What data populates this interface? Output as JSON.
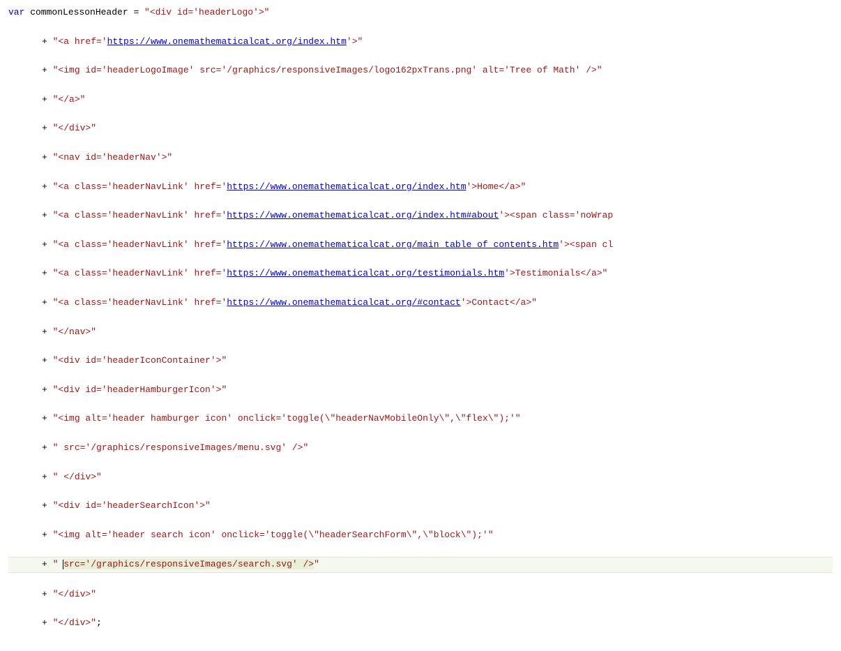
{
  "code": {
    "line1": {
      "kw": "var",
      "ident": " commonLessonHeader ",
      "op": "= ",
      "str": "\"<div id='headerLogo'>\""
    },
    "line2": {
      "op": "+ ",
      "str1": "\"<a href='",
      "url": "https://www.onemathematicalcat.org/index.htm",
      "str2": "'>\""
    },
    "line3": {
      "op": "+ ",
      "str": "\"<img id='headerLogoImage' src='/graphics/responsiveImages/logo162pxTrans.png' alt='Tree of Math' />\""
    },
    "line4": {
      "op": "+ ",
      "str": "\"</a>\""
    },
    "line5": {
      "op": "+ ",
      "str": "\"</div>\""
    },
    "line6": {
      "op": "+ ",
      "str": "\"<nav id='headerNav'>\""
    },
    "line7": {
      "op": "+ ",
      "str1": "\"<a class='headerNavLink' href='",
      "url": "https://www.onemathematicalcat.org/index.htm",
      "str2": "'>Home</a>\""
    },
    "line8": {
      "op": "+ ",
      "str1": "\"<a class='headerNavLink' href='",
      "url": "https://www.onemathematicalcat.org/index.htm#about",
      "str2": "'><span class='noWrap"
    },
    "line9": {
      "op": "+ ",
      "str1": "\"<a class='headerNavLink' href='",
      "url": "https://www.onemathematicalcat.org/main_table_of_contents.htm",
      "str2": "'><span cl"
    },
    "line10": {
      "op": "+ ",
      "str1": "\"<a class='headerNavLink' href='",
      "url": "https://www.onemathematicalcat.org/testimonials.htm",
      "str2": "'>Testimonials</a>\""
    },
    "line11": {
      "op": "+ ",
      "str1": "\"<a class='headerNavLink' href='",
      "url": "https://www.onemathematicalcat.org/#contact",
      "str2": "'>Contact</a>\""
    },
    "line12": {
      "op": "+ ",
      "str": "\"</nav>\""
    },
    "line13": {
      "op": "+ ",
      "str": "\"<div id='headerIconContainer'>\""
    },
    "line14": {
      "op": "+ ",
      "str": "\"<div id='headerHamburgerIcon'>\""
    },
    "line15": {
      "op": "+ ",
      "str": "\"<img alt='header hamburger icon' onclick='toggle(\\\"headerNavMobileOnly\\\",\\\"flex\\\");'\""
    },
    "line16": {
      "op": "+ ",
      "str": "\" src='/graphics/responsiveImages/menu.svg' />\""
    },
    "line17": {
      "op": "+ ",
      "str": "\" </div>\""
    },
    "line18": {
      "op": "+ ",
      "str": "\"<div id='headerSearchIcon'>\""
    },
    "line19": {
      "op": "+ ",
      "str": "\"<img alt='header search icon' onclick='toggle(\\\"headerSearchForm\\\",\\\"block\\\");'\""
    },
    "line20": {
      "op": "+ ",
      "str1": "\" ",
      "str2": "src='/graphics/responsiveImages/search.svg' />",
      "str3": "\""
    },
    "line21": {
      "op": "+ ",
      "str": "\"</div>\""
    },
    "line22": {
      "op": "+ ",
      "str": "\"</div>\"",
      "semi": ";"
    }
  }
}
